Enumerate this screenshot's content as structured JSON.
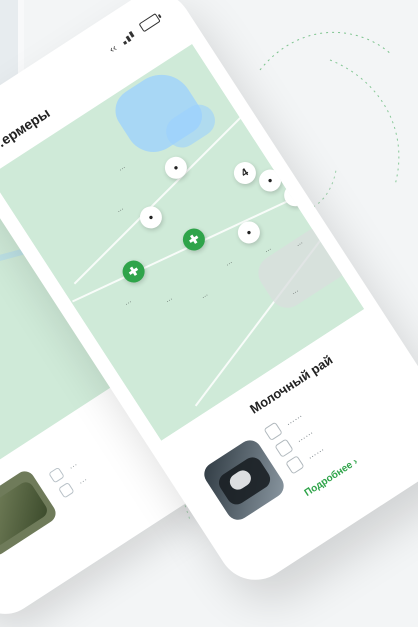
{
  "front_phone": {
    "header": {
      "title": "…ермеры",
      "status": "‹‹"
    },
    "map": {
      "pins": [
        {
          "type": "white",
          "label": ""
        },
        {
          "type": "white",
          "label": ""
        },
        {
          "type": "white",
          "label": "4"
        },
        {
          "type": "white",
          "label": ""
        },
        {
          "type": "white",
          "label": ""
        },
        {
          "type": "white",
          "label": ""
        },
        {
          "type": "green",
          "label": ""
        },
        {
          "type": "green",
          "label": ""
        }
      ],
      "labels": [
        "…",
        "…",
        "…",
        "…",
        "…",
        "…",
        "…",
        "…",
        "…"
      ]
    },
    "place_card": {
      "title": "Молочный рай",
      "details": [
        {
          "icon": "clock-icon",
          "text": "……"
        },
        {
          "icon": "calendar-icon",
          "text": "……"
        },
        {
          "icon": "phone-icon",
          "text": "……"
        }
      ],
      "action_label": "Подробнее ›"
    }
  },
  "back_phone": {
    "card": {
      "details": [
        {
          "icon": "info-icon",
          "text": "…"
        },
        {
          "icon": "bookmark-icon",
          "text": "…"
        }
      ]
    }
  },
  "colors": {
    "map_green": "#cfead8",
    "pin_green": "#2fa44a",
    "water_blue": "#9bd0ff",
    "background": "#f3f5f6"
  }
}
